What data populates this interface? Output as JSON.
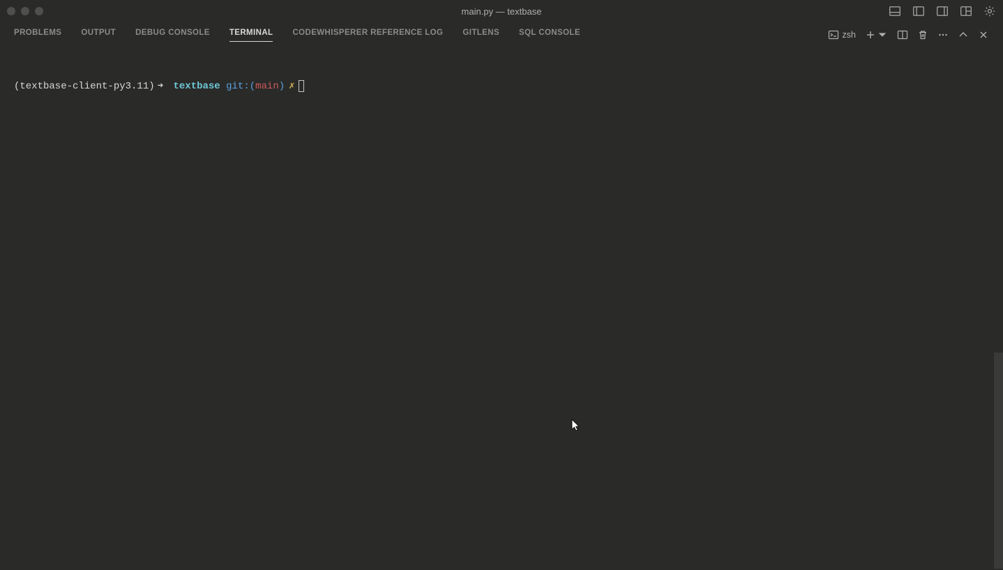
{
  "window": {
    "title": "main.py — textbase"
  },
  "panel": {
    "tabs": [
      {
        "label": "PROBLEMS"
      },
      {
        "label": "OUTPUT"
      },
      {
        "label": "DEBUG CONSOLE"
      },
      {
        "label": "TERMINAL"
      },
      {
        "label": "CODEWHISPERER REFERENCE LOG"
      },
      {
        "label": "GITLENS"
      },
      {
        "label": "SQL CONSOLE"
      }
    ],
    "active_tab": "TERMINAL",
    "shell_label": "zsh"
  },
  "terminal": {
    "prompt": {
      "venv": "(textbase-client-py3.11)",
      "arrow": "➜",
      "dir": "textbase",
      "git_label": "git:",
      "paren_open": "(",
      "branch": "main",
      "paren_close": ")",
      "dirty_marker": "✗"
    }
  }
}
